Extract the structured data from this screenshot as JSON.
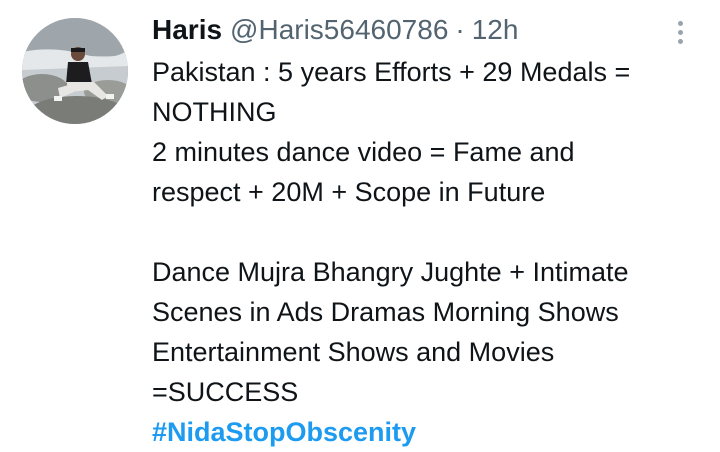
{
  "tweet": {
    "author": {
      "name": "Haris",
      "handle": "@Haris56460786",
      "separator": "·",
      "time": "12h"
    },
    "icons": {
      "avatar": "user-avatar",
      "more": "more-vertical-icon"
    },
    "text_lines": [
      "Pakistan : 5 years Efforts + 29 Medals =",
      "NOTHING",
      "2 minutes dance video =  Fame and",
      "respect + 20M + Scope in Future",
      "",
      "Dance Mujra Bhangry Jughte + Intimate",
      "Scenes in Ads Dramas  Morning Shows",
      "Entertainment Shows and Movies",
      "=SUCCESS"
    ],
    "hashtag": "#NidaStopObscenity"
  },
  "colors": {
    "text": "#0f1419",
    "secondary": "#536471",
    "link": "#1d9bf0"
  }
}
